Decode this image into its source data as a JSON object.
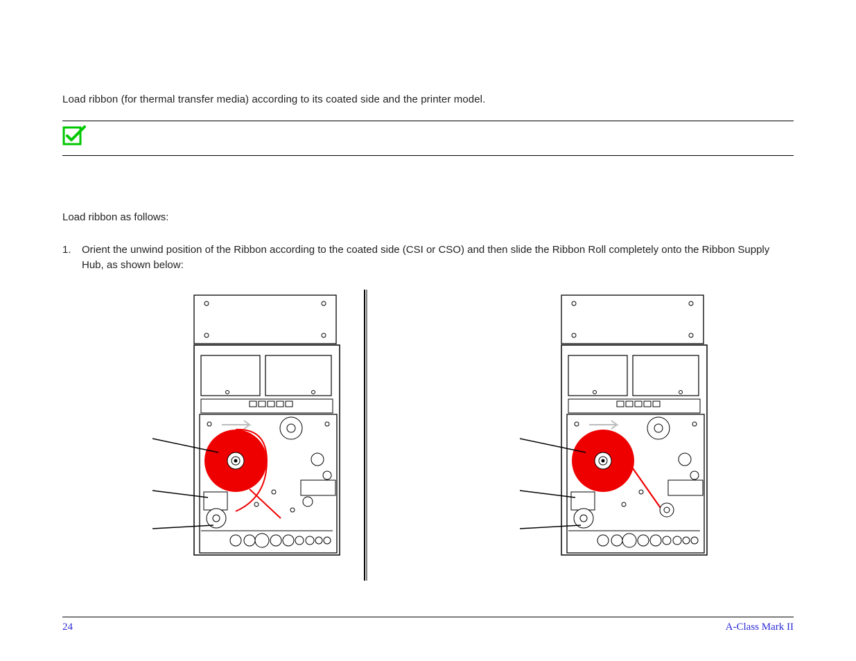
{
  "intro": "Load ribbon (for thermal transfer media) according to its coated side and the printer model.",
  "lead": "Load ribbon as follows:",
  "step1_num": "1.",
  "step1_body": "Orient the unwind position of the Ribbon according to the coated side (CSI or CSO) and then slide the Ribbon Roll completely onto the Ribbon Supply Hub, as shown below:",
  "footer": {
    "page_number": "24",
    "model": "A-Class Mark II"
  }
}
